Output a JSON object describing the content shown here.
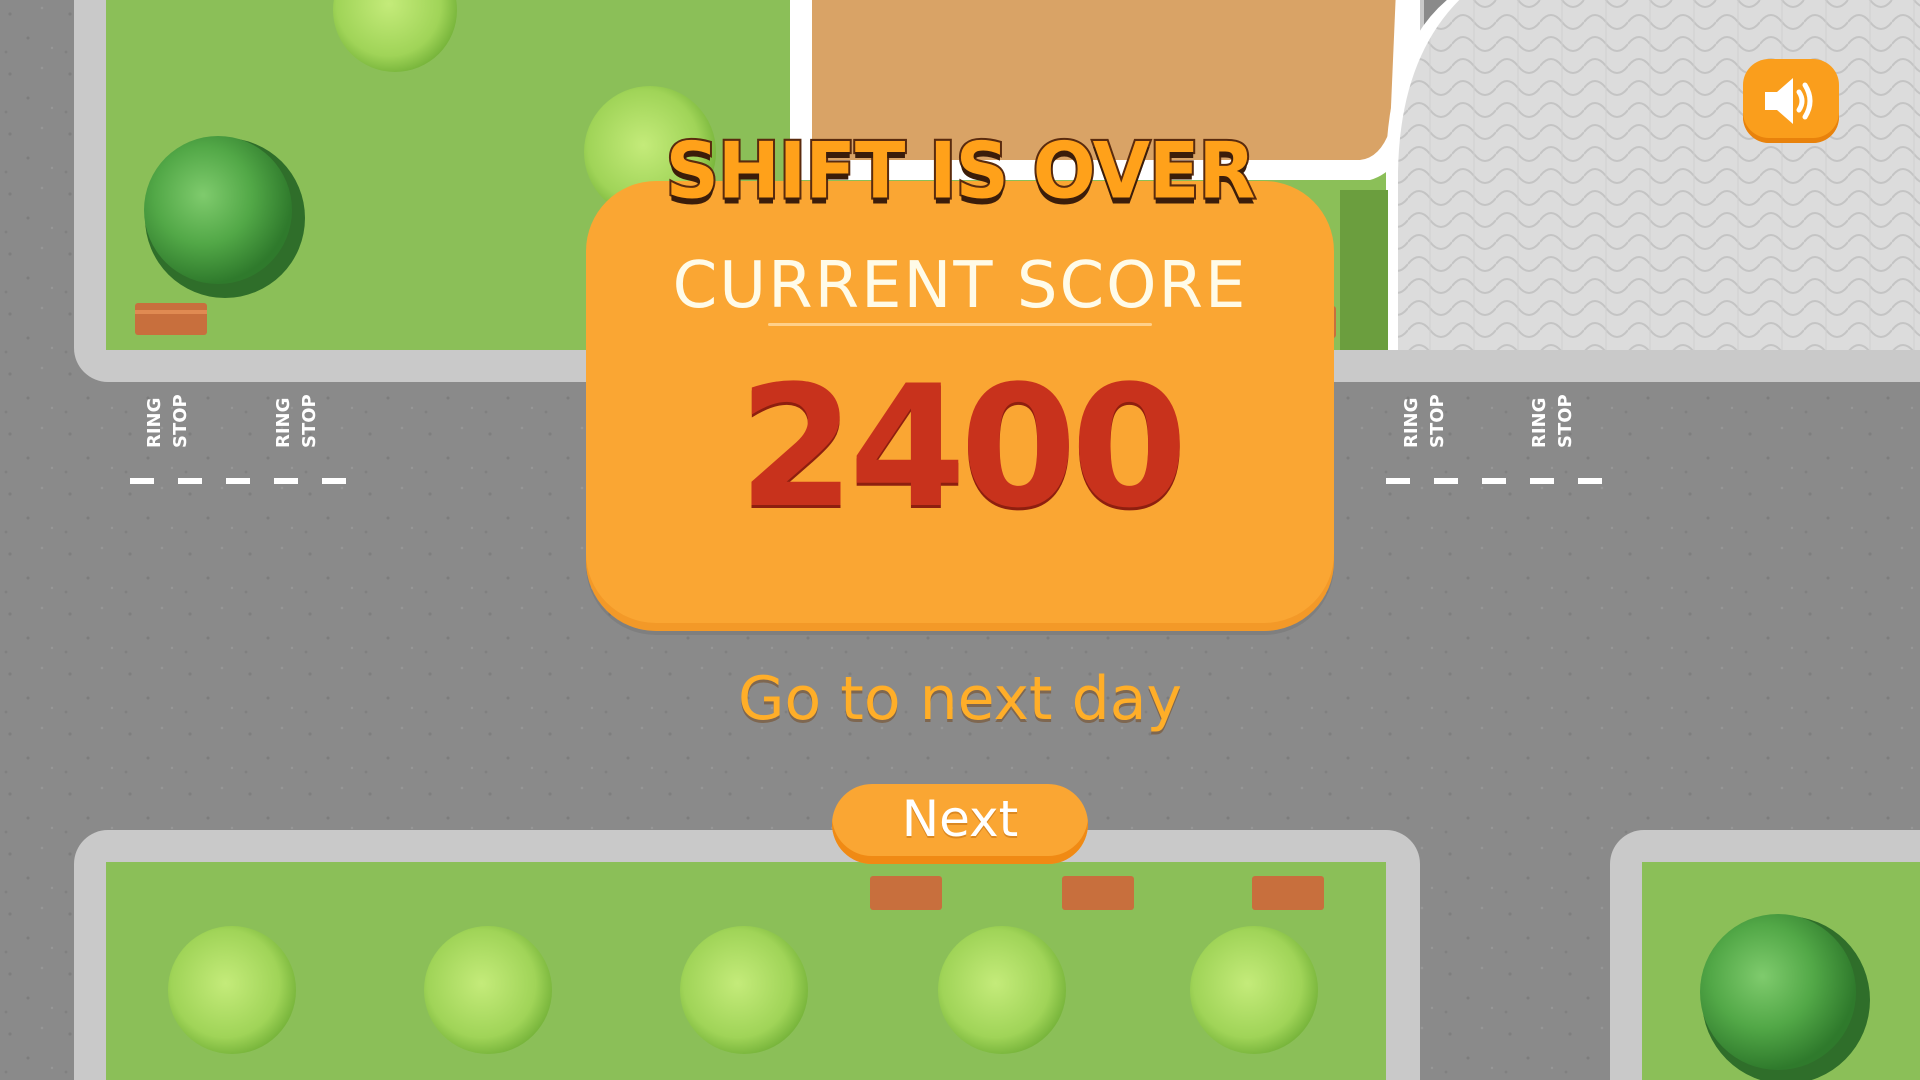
{
  "title": "SHIFT IS OVER",
  "score_label": "CURRENT SCORE",
  "score_value": "2400",
  "next_day_text": "Go to next day",
  "next_button_label": "Next",
  "ring_stop_sign": {
    "line1": "RING",
    "line2": "STOP"
  },
  "icons": {
    "sound": "speaker-volume-icon"
  },
  "colors": {
    "panel_orange": "#faa633",
    "score_red": "#c8321c",
    "grass": "#8bbf58",
    "road": "#8a8a8a"
  }
}
